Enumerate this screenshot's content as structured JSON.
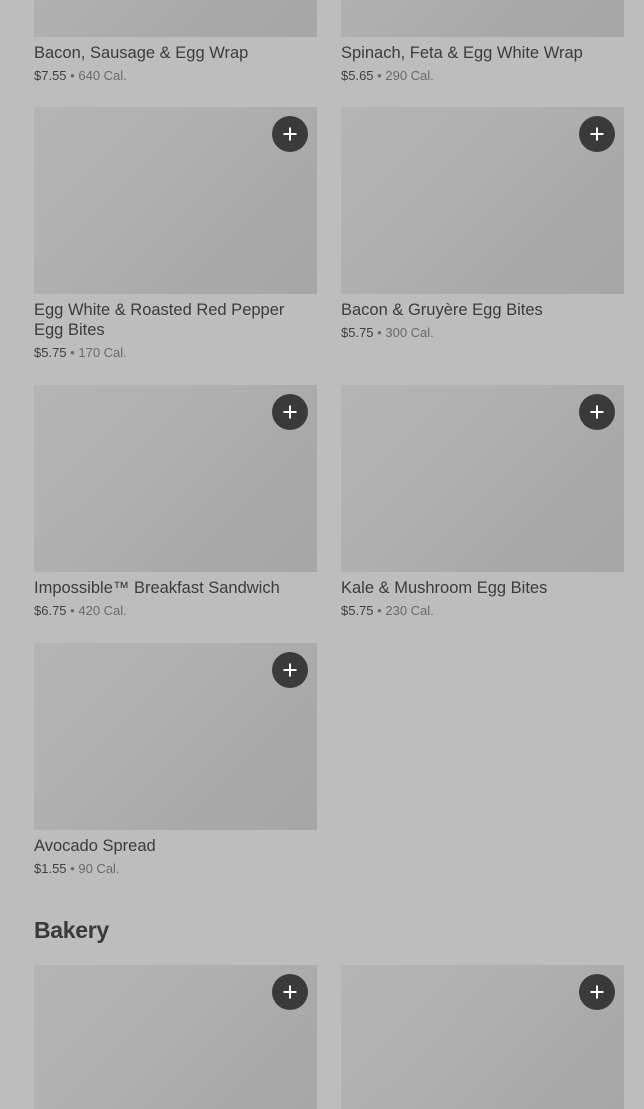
{
  "items": [
    {
      "name": "Bacon, Sausage & Egg Wrap",
      "price": "$7.55",
      "separator": "•",
      "calories": "640 Cal."
    },
    {
      "name": "Spinach, Feta & Egg White Wrap",
      "price": "$5.65",
      "separator": "•",
      "calories": "290 Cal."
    },
    {
      "name": "Egg White & Roasted Red Pepper Egg Bites",
      "price": "$5.75",
      "separator": "•",
      "calories": "170 Cal."
    },
    {
      "name": "Bacon & Gruyère Egg Bites",
      "price": "$5.75",
      "separator": "•",
      "calories": "300 Cal."
    },
    {
      "name": "Impossible™ Breakfast Sandwich",
      "price": "$6.75",
      "separator": "•",
      "calories": "420 Cal."
    },
    {
      "name": "Kale & Mushroom Egg Bites",
      "price": "$5.75",
      "separator": "•",
      "calories": "230 Cal."
    },
    {
      "name": "Avocado Spread",
      "price": "$1.55",
      "separator": "•",
      "calories": "90 Cal."
    }
  ],
  "bakery": {
    "title": "Bakery"
  },
  "icons": {
    "add": "plus-icon"
  },
  "colors": {
    "background": "#bdbdbd",
    "add_button": "#3a3a3a"
  }
}
